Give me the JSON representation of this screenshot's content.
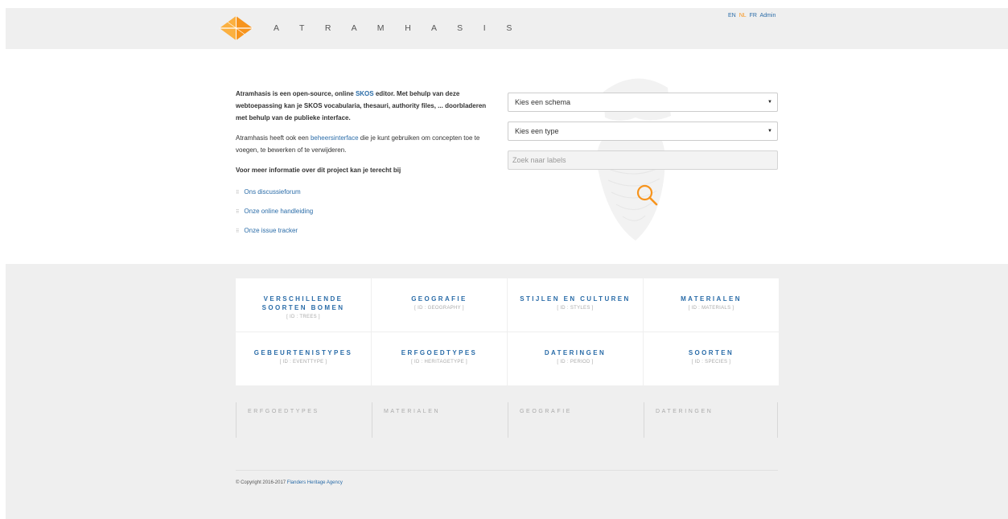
{
  "brand": "A T R A M H A S I S",
  "languages": [
    {
      "label": "EN",
      "active": false
    },
    {
      "label": "NL",
      "active": true
    },
    {
      "label": "FR",
      "active": false
    },
    {
      "label": "Admin",
      "active": false
    }
  ],
  "intro": {
    "lead_1": "Atramhasis is een open-source, online ",
    "lead_link": "SKOS",
    "lead_2": " editor. Met behulp van deze webtoepassing kan je SKOS vocabularia, thesauri, authority files, ... doorbladeren met behulp van de publieke interface.",
    "p2_1": "Atramhasis heeft ook een ",
    "p2_link": "beheersinterface",
    "p2_2": " die je kunt gebruiken om concepten toe te voegen, te bewerken of te verwijderen.",
    "more": "Voor meer informatie over dit project kan je terecht bij",
    "links": [
      "Ons discussieforum",
      "Onze online handleiding",
      "Onze issue tracker"
    ],
    "bullet": "⠿"
  },
  "form": {
    "schema_select": "Kies een schema",
    "type_select": "Kies een type",
    "search_placeholder": "Zoek naar labels",
    "caret": "▼"
  },
  "schemes": [
    {
      "title": "VERSCHILLENDE SOORTEN BOMEN",
      "id": "[ ID : TREES ]"
    },
    {
      "title": "GEOGRAFIE",
      "id": "[ ID : GEOGRAPHY ]"
    },
    {
      "title": "STIJLEN EN CULTUREN",
      "id": "[ ID : STYLES ]"
    },
    {
      "title": "MATERIALEN",
      "id": "[ ID : MATERIALS ]"
    },
    {
      "title": "GEBEURTENISTYPES",
      "id": "[ ID : EVENTTYPE ]"
    },
    {
      "title": "ERFGOEDTYPES",
      "id": "[ ID : HERITAGETYPE ]"
    },
    {
      "title": "DATERINGEN",
      "id": "[ ID : PERIOD ]"
    },
    {
      "title": "SOORTEN",
      "id": "[ ID : SPECIES ]"
    }
  ],
  "columns": [
    "ERFGOEDTYPES",
    "MATERIALEN",
    "GEOGRAFIE",
    "DATERINGEN"
  ],
  "footer": {
    "copyright": "© Copyright 2016-2017 ",
    "agency": "Flanders Heritage Agency"
  },
  "colors": {
    "accent": "#f7941d",
    "link": "#2a6ca8",
    "band": "#efefef"
  }
}
